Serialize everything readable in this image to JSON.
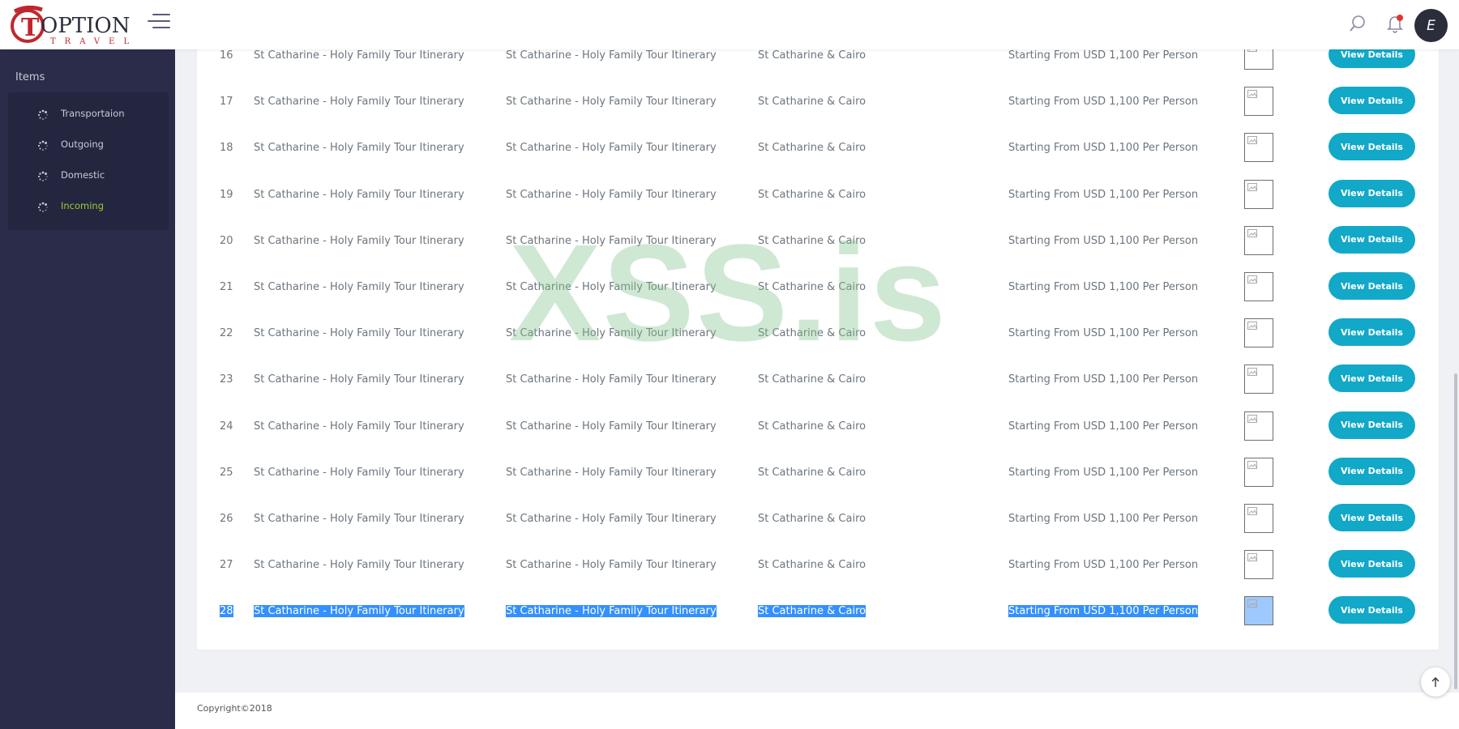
{
  "brand": {
    "logo_text": "OPTION",
    "logo_subtext": "TRAVEL",
    "logo_initial": "T"
  },
  "header": {
    "avatar_initial": "E"
  },
  "sidebar": {
    "heading": "Items",
    "items": [
      {
        "label": "Transportaion",
        "active": false
      },
      {
        "label": "Outgoing",
        "active": false
      },
      {
        "label": "Domestic",
        "active": false
      },
      {
        "label": "Incoming",
        "active": true
      }
    ]
  },
  "table": {
    "button_label": "View Details",
    "rows": [
      {
        "num": "16",
        "name": "St Catharine - Holy Family Tour Itinerary",
        "title": "St Catharine - Holy Family Tour Itinerary",
        "destination": "St Catharine & Cairo",
        "price": "Starting From USD 1,100 Per Person"
      },
      {
        "num": "17",
        "name": "St Catharine - Holy Family Tour Itinerary",
        "title": "St Catharine - Holy Family Tour Itinerary",
        "destination": "St Catharine & Cairo",
        "price": "Starting From USD 1,100 Per Person"
      },
      {
        "num": "18",
        "name": "St Catharine - Holy Family Tour Itinerary",
        "title": "St Catharine - Holy Family Tour Itinerary",
        "destination": "St Catharine & Cairo",
        "price": "Starting From USD 1,100 Per Person"
      },
      {
        "num": "19",
        "name": "St Catharine - Holy Family Tour Itinerary",
        "title": "St Catharine - Holy Family Tour Itinerary",
        "destination": "St Catharine & Cairo",
        "price": "Starting From USD 1,100 Per Person"
      },
      {
        "num": "20",
        "name": "St Catharine - Holy Family Tour Itinerary",
        "title": "St Catharine - Holy Family Tour Itinerary",
        "destination": "St Catharine & Cairo",
        "price": "Starting From USD 1,100 Per Person"
      },
      {
        "num": "21",
        "name": "St Catharine - Holy Family Tour Itinerary",
        "title": "St Catharine - Holy Family Tour Itinerary",
        "destination": "St Catharine & Cairo",
        "price": "Starting From USD 1,100 Per Person"
      },
      {
        "num": "22",
        "name": "St Catharine - Holy Family Tour Itinerary",
        "title": "St Catharine - Holy Family Tour Itinerary",
        "destination": "St Catharine & Cairo",
        "price": "Starting From USD 1,100 Per Person"
      },
      {
        "num": "23",
        "name": "St Catharine - Holy Family Tour Itinerary",
        "title": "St Catharine - Holy Family Tour Itinerary",
        "destination": "St Catharine & Cairo",
        "price": "Starting From USD 1,100 Per Person"
      },
      {
        "num": "24",
        "name": "St Catharine - Holy Family Tour Itinerary",
        "title": "St Catharine - Holy Family Tour Itinerary",
        "destination": "St Catharine & Cairo",
        "price": "Starting From USD 1,100 Per Person"
      },
      {
        "num": "25",
        "name": "St Catharine - Holy Family Tour Itinerary",
        "title": "St Catharine - Holy Family Tour Itinerary",
        "destination": "St Catharine & Cairo",
        "price": "Starting From USD 1,100 Per Person"
      },
      {
        "num": "26",
        "name": "St Catharine - Holy Family Tour Itinerary",
        "title": "St Catharine - Holy Family Tour Itinerary",
        "destination": "St Catharine & Cairo",
        "price": "Starting From USD 1,100 Per Person"
      },
      {
        "num": "27",
        "name": "St Catharine - Holy Family Tour Itinerary",
        "title": "St Catharine - Holy Family Tour Itinerary",
        "destination": "St Catharine & Cairo",
        "price": "Starting From USD 1,100 Per Person"
      },
      {
        "num": "28",
        "name": "St Catharine - Holy Family Tour Itinerary",
        "title": "St Catharine - Holy Family Tour Itinerary",
        "destination": "St Catharine & Cairo",
        "price": "Starting From USD 1,100 Per Person",
        "selected": true
      }
    ]
  },
  "watermark": "XSS.is",
  "footer": {
    "copyright": "Copyright©2018"
  },
  "icons": {
    "menu": "hamburger-icon",
    "search": "search-icon",
    "notifications": "bell-icon",
    "item": "spinner-icon",
    "image": "broken-image-icon",
    "back_to_top": "arrow-up-icon"
  },
  "colors": {
    "sidebar": "#2a2c4a",
    "sidebar_menu": "#24263f",
    "accent_button": "#12a8c8",
    "active_menu": "#9acd32",
    "notification_dot": "#e3342f",
    "selection": "#3390ff",
    "logo_red": "#c0272d"
  }
}
